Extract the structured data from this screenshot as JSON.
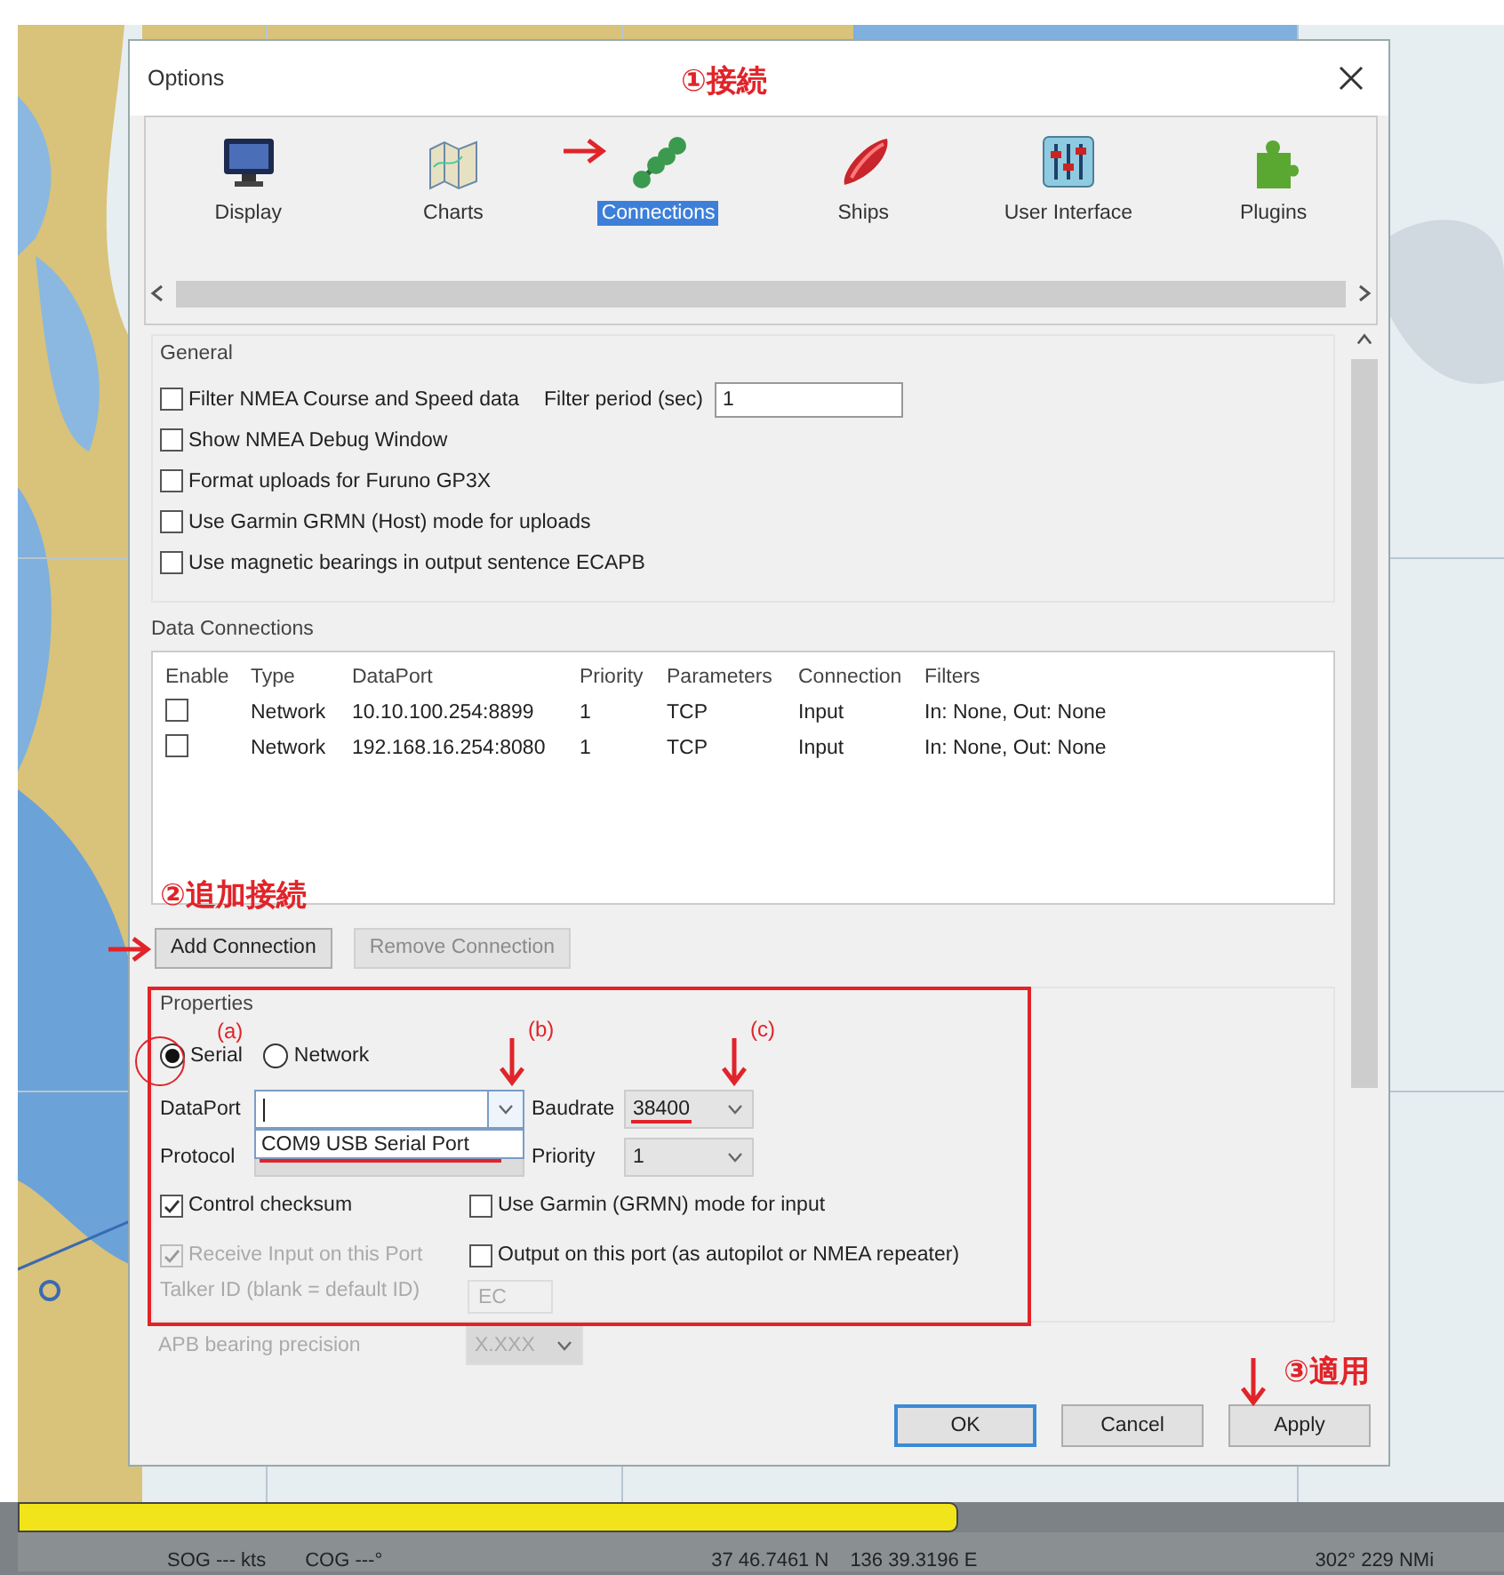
{
  "window": {
    "title": "Options"
  },
  "toolbar": {
    "items": [
      {
        "label": "Display",
        "selected": false
      },
      {
        "label": "Charts",
        "selected": false
      },
      {
        "label": "Connections",
        "selected": true
      },
      {
        "label": "Ships",
        "selected": false
      },
      {
        "label": "User Interface",
        "selected": false
      },
      {
        "label": "Plugins",
        "selected": false
      }
    ]
  },
  "general": {
    "title": "General",
    "options": [
      {
        "label": "Filter NMEA Course and Speed data",
        "checked": false
      },
      {
        "label": "Show NMEA Debug Window",
        "checked": false
      },
      {
        "label": "Format uploads for Furuno GP3X",
        "checked": false
      },
      {
        "label": "Use Garmin GRMN (Host) mode for uploads",
        "checked": false
      },
      {
        "label": "Use magnetic bearings in output sentence ECAPB",
        "checked": false
      }
    ],
    "filter_period": {
      "label": "Filter period (sec)",
      "value": "1"
    }
  },
  "data_connections": {
    "title": "Data Connections",
    "columns": {
      "enable": "Enable",
      "type": "Type",
      "dataport": "DataPort",
      "priority": "Priority",
      "parameters": "Parameters",
      "connection": "Connection",
      "filters": "Filters"
    },
    "rows": [
      {
        "enabled": false,
        "type": "Network",
        "dataport": "10.10.100.254:8899",
        "priority": "1",
        "parameters": "TCP",
        "connection": "Input",
        "filters": "In: None, Out: None"
      },
      {
        "enabled": false,
        "type": "Network",
        "dataport": "192.168.16.254:8080",
        "priority": "1",
        "parameters": "TCP",
        "connection": "Input",
        "filters": "In: None, Out: None"
      }
    ],
    "buttons": [
      {
        "label": "Add Connection",
        "disabled": false
      },
      {
        "label": "Remove Connection",
        "disabled": true
      }
    ]
  },
  "properties": {
    "title": "Properties",
    "modes": [
      {
        "label": "Serial",
        "selected": true
      },
      {
        "label": "Network",
        "selected": false
      }
    ],
    "dataport": {
      "label": "DataPort",
      "options": [
        "COM9 USB Serial Port"
      ]
    },
    "baudrate": {
      "label": "Baudrate",
      "value": "38400"
    },
    "protocol": {
      "label": "Protocol"
    },
    "priority": {
      "label": "Priority",
      "value": "1"
    },
    "options": [
      {
        "label": "Control checksum",
        "checked": true,
        "disabled": false
      },
      {
        "label": "Use Garmin (GRMN) mode for input",
        "checked": false,
        "disabled": false
      },
      {
        "label": "Receive Input on this Port",
        "checked": true,
        "disabled": true
      },
      {
        "label": "Output on this port (as autopilot or NMEA repeater)",
        "checked": false,
        "disabled": false
      }
    ],
    "talker_id": {
      "label": "Talker ID (blank = default ID)",
      "value": "EC",
      "disabled": true
    },
    "apb_precision": {
      "label": "APB bearing precision",
      "value": "X.XXX",
      "disabled": true
    }
  },
  "buttons": [
    {
      "label": "OK",
      "default": true
    },
    {
      "label": "Cancel",
      "default": false
    },
    {
      "label": "Apply",
      "default": false
    }
  ],
  "status_bar": {
    "level": 0.63,
    "items": [
      "SOG --- kts",
      "COG ---°",
      "37 46.7461 N",
      "136 39.3196 E",
      "302° 229 NMi"
    ]
  },
  "annotations": [
    {
      "kind": "label",
      "text": "①接続"
    },
    {
      "kind": "arrow_right"
    },
    {
      "kind": "label",
      "text": "②追加接続"
    },
    {
      "kind": "arrow_right"
    },
    {
      "kind": "frame"
    },
    {
      "kind": "circle"
    },
    {
      "kind": "note",
      "text": "(a)"
    },
    {
      "kind": "arrow_down"
    },
    {
      "kind": "note",
      "text": "(b)"
    },
    {
      "kind": "arrow_down"
    },
    {
      "kind": "note",
      "text": "(c)"
    },
    {
      "kind": "underline"
    },
    {
      "kind": "underline"
    },
    {
      "kind": "arrow_down"
    },
    {
      "kind": "label",
      "text": "③適用"
    }
  ]
}
